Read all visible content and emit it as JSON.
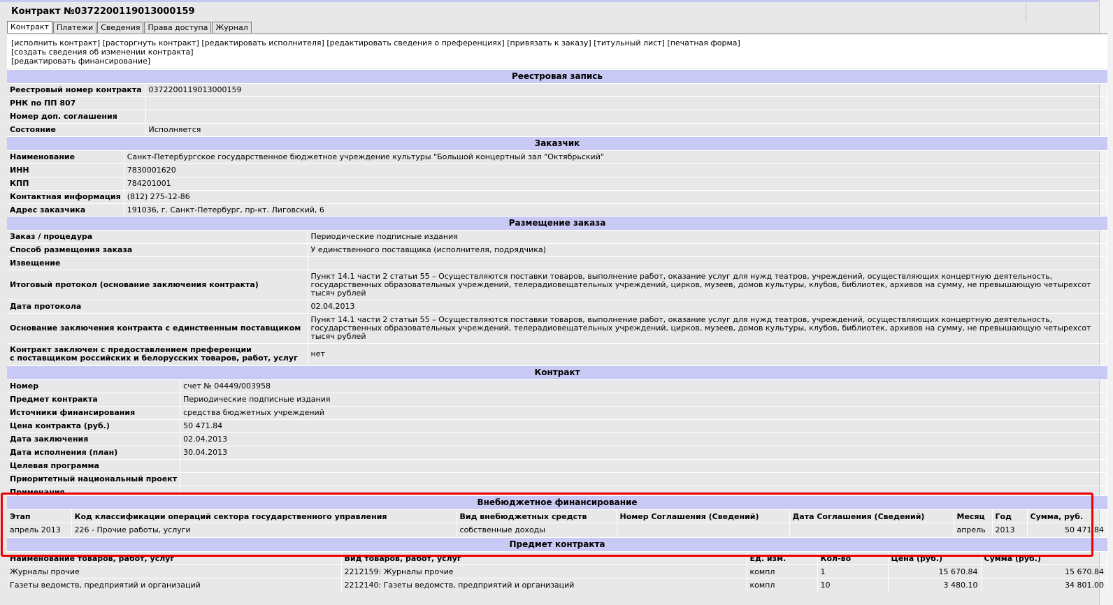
{
  "page_title": "Контракт №0372200119013000159",
  "tabs": [
    "Контракт",
    "Платежи",
    "Сведения",
    "Права доступа",
    "Журнал"
  ],
  "actions": {
    "line1": [
      "[исполнить контракт]",
      "[расторгнуть контракт]",
      "[редактировать исполнителя]",
      "[редактировать сведения о преференциях]",
      "[привязать к заказу]",
      "[титульный лист]",
      "[печатная форма]"
    ],
    "line2": [
      "[создать сведения об изменении контракта]"
    ],
    "line3": [
      "[редактировать финансирование]"
    ]
  },
  "registry": {
    "title": "Реестровая запись",
    "rows": [
      {
        "k": "Реестровый номер контракта",
        "v": "0372200119013000159"
      },
      {
        "k": "РНК по ПП 807",
        "v": ""
      },
      {
        "k": "Номер доп. соглашения",
        "v": ""
      },
      {
        "k": "Состояние",
        "v": "Исполняется"
      }
    ]
  },
  "customer": {
    "title": "Заказчик",
    "rows": [
      {
        "k": "Наименование",
        "v": "Санкт-Петербургское государственное бюджетное учреждение культуры \"Большой концертный зал \"Октябрьский\""
      },
      {
        "k": "ИНН",
        "v": "7830001620"
      },
      {
        "k": "КПП",
        "v": "784201001"
      },
      {
        "k": "Контактная информация",
        "v": "(812) 275-12-86"
      },
      {
        "k": "Адрес заказчика",
        "v": "191036, г. Санкт-Петербург, пр-кт. Лиговский, 6"
      }
    ]
  },
  "placement": {
    "title": "Размещение заказа",
    "rows": [
      {
        "k": "Заказ / процедура",
        "v": "Периодические подписные издания"
      },
      {
        "k": "Способ размещения заказа",
        "v": "У единственного поставщика (исполнителя, подрядчика)"
      },
      {
        "k": "Извещение",
        "v": ""
      },
      {
        "k": "Итоговый протокол (основание заключения контракта)",
        "v": "Пункт 14.1 части 2 статьи 55 – Осуществляются поставки товаров, выполнение работ, оказание услуг для нужд театров, учреждений, осуществляющих концертную деятельность, государственных образовательных учреждений, телерадиовещательных учреждений, цирков, музеев, домов культуры, клубов, библиотек, архивов на сумму, не превышающую четырехсот тысяч рублей"
      },
      {
        "k": "Дата протокола",
        "v": "02.04.2013"
      },
      {
        "k": "Основание заключения контракта с единственным поставщиком",
        "v": "Пункт 14.1 части 2 статьи 55 – Осуществляются поставки товаров, выполнение работ, оказание услуг для нужд театров, учреждений, осуществляющих концертную деятельность, государственных образовательных учреждений, телерадиовещательных учреждений, цирков, музеев, домов культуры, клубов, библиотек, архивов на сумму, не превышающую четырехсот тысяч рублей"
      },
      {
        "k": "Контракт заключен с предоставлением преференции\nс поставщиком российских и белорусских товаров, работ, услуг",
        "v": "нет"
      }
    ]
  },
  "contract": {
    "title": "Контракт",
    "rows": [
      {
        "k": "Номер",
        "v": "счет № 04449/003958"
      },
      {
        "k": "Предмет контракта",
        "v": "Периодические подписные издания"
      },
      {
        "k": "Источники финансирования",
        "v": "средства бюджетных учреждений"
      },
      {
        "k": "Цена контракта (руб.)",
        "v": "50 471.84"
      },
      {
        "k": "Дата заключения",
        "v": "02.04.2013"
      },
      {
        "k": "Дата исполнения (план)",
        "v": "30.04.2013"
      },
      {
        "k": "Целевая программа",
        "v": ""
      },
      {
        "k": "Приоритетный национальный проект",
        "v": ""
      },
      {
        "k": "Примечания",
        "v": ""
      }
    ]
  },
  "funding": {
    "title": "Внебюджетное финансирование",
    "headers": [
      "Этап",
      "Код классификации операций сектора государственного управления",
      "Вид внебюджетных средств",
      "Номер Соглашения (Сведений)",
      "Дата Соглашения (Сведений)",
      "Месяц",
      "Год",
      "Сумма, руб."
    ],
    "rows": [
      [
        "апрель 2013",
        "226 - Прочие работы, услуги",
        "собственные доходы",
        "",
        "",
        "апрель",
        "2013",
        "50 471.84"
      ]
    ]
  },
  "subject": {
    "title": "Предмет контракта",
    "headers": [
      "Наименование товаров, работ, услуг",
      "Вид товаров, работ, услуг",
      "Ед. изм.",
      "Кол-во",
      "Цена (руб.)",
      "Сумма (руб.)"
    ],
    "rows": [
      [
        "Журналы прочие",
        "2212159: Журналы прочие",
        "компл",
        "1",
        "15 670.84",
        "15 670.84"
      ],
      [
        "Газеты ведомств, предприятий и организаций",
        "2212140: Газеты ведомств, предприятий и организаций",
        "компл",
        "10",
        "3 480.10",
        "34 801.00"
      ]
    ]
  },
  "colors": {
    "section_header": "#c9c9f5",
    "highlight": "#ee0000",
    "background": "#e8e8e8"
  }
}
